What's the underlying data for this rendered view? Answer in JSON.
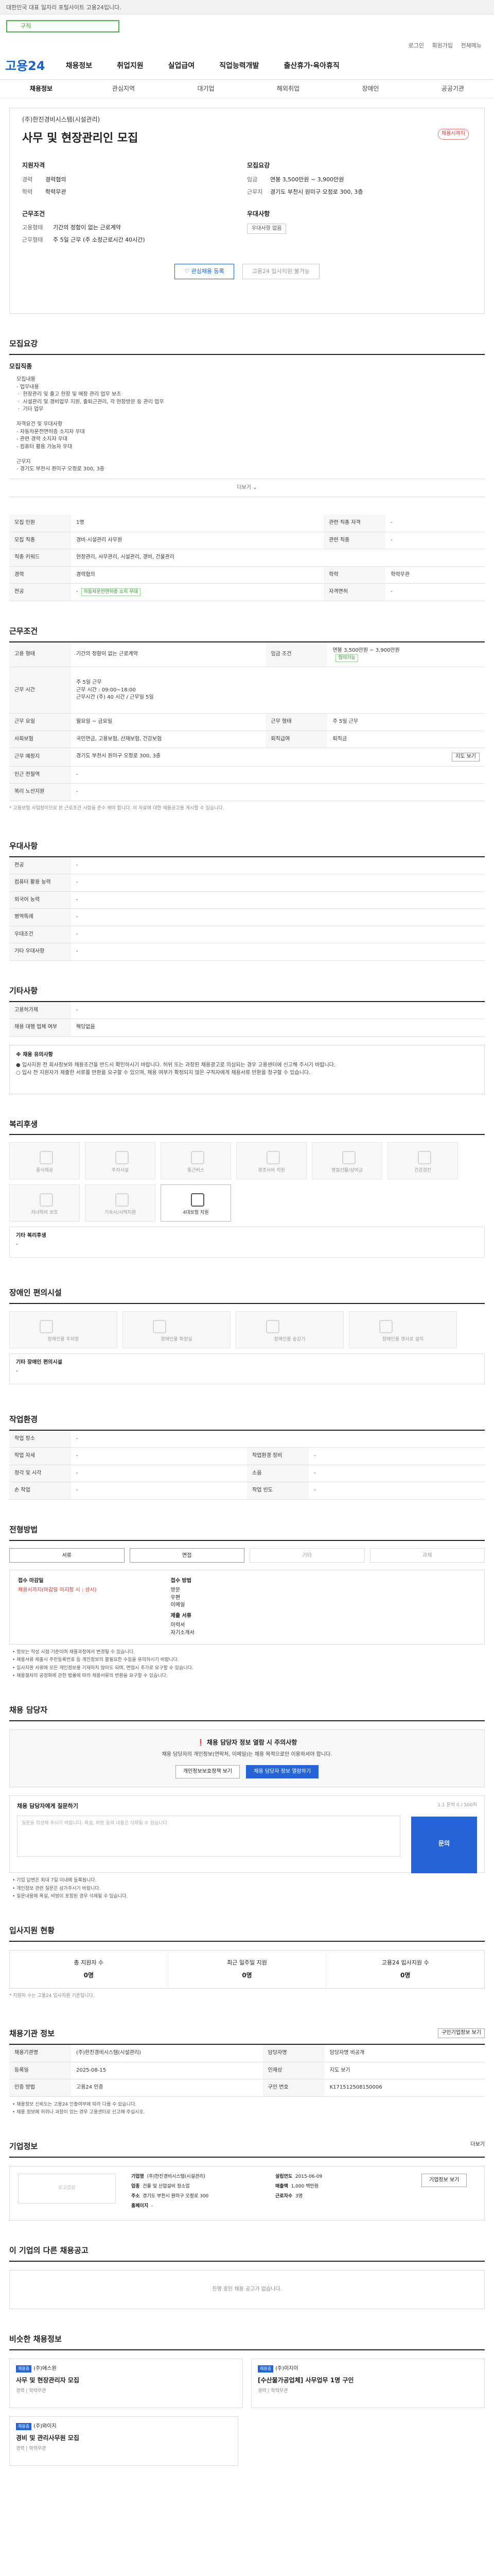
{
  "topbar": {
    "text": "대한민국 대표 일자리 포털사이트 고용24입니다."
  },
  "search": {
    "value": "구직"
  },
  "util": {
    "login": "로그인",
    "join": "회원가입",
    "sitemap": "전체메뉴"
  },
  "gnb": {
    "logo": "고용24",
    "items": [
      "채용정보",
      "취업지원",
      "실업급여",
      "직업능력개발",
      "출산휴가·육아휴직"
    ]
  },
  "subnav": [
    "채용정보",
    "관심지역",
    "대기업",
    "해외취업",
    "장애인",
    "공공기관"
  ],
  "job": {
    "company_label": "기업정보",
    "company": "(주)한진경비시스템(시설관리)",
    "title": "사무 및 현장관리인 모집",
    "close_badge": "채용시까지",
    "left_title": "지원자격",
    "left": [
      {
        "k": "경력",
        "v": "경력협의"
      },
      {
        "k": "학력",
        "v": "학력무관"
      }
    ],
    "left2_title": "근무조건",
    "left2": [
      {
        "k": "고용형태",
        "v": "기간의 정함이 없는 근로계약"
      },
      {
        "k": "근무형태",
        "v": "주 5일 근무 (주 소정근로시간 40시간)"
      }
    ],
    "right_title": "모집요강",
    "right": [
      {
        "k": "임금",
        "v": "연봉 3,500만원 ~ 3,900만원"
      },
      {
        "k": "근무지",
        "v": "경기도 부천시 원미구 오정로 300, 3층"
      }
    ],
    "right2_title": "우대사항",
    "right2_note": "우대사항 없음",
    "btn_interest": "관심채용 등록",
    "btn_apply": "고용24 입사지원 불가능"
  },
  "detail": {
    "title": "모집요강",
    "sub1": "모집직종",
    "body": "모집내용\n- 업무내용\n  ㆍ 현장관리 및 출고 현장 및 매장 관리 업무 보조\n  ㆍ 시설관리 및 경비업무 지원, 출퇴근관리, 각 현장방문 등 관리 업무\n  ㆍ 기타 업무\n\n자격요건 및 우대사항\n- 자동차운전면허증 소지자 우대\n- 관련 경력 소지자 우대\n- 컴퓨터 활용 가능자 우대\n\n근무지\n- 경기도 부천시 원미구 오정로 300, 3층",
    "more": "더보기",
    "rows": [
      {
        "k": "모집 인원",
        "v": "1명",
        "k2": "관련 직종 자격",
        "v2": "-"
      },
      {
        "k": "모집 직종",
        "v": "경비·시설관리 사무원",
        "k2": "관련 직종",
        "v2": "-"
      },
      {
        "k": "직종 키워드",
        "v": "현장관리, 사무관리, 시설관리, 경비, 건물관리",
        "k2": "",
        "v2": ""
      },
      {
        "k": "경력",
        "v": "경력협의",
        "k2": "학력",
        "v2": "학력무관"
      },
      {
        "k": "전공",
        "v": "-",
        "k2": "자격면허",
        "v2": "-"
      }
    ],
    "mid_note": "자동차운전면허증 소지 우대"
  },
  "cond": {
    "title": "근무조건",
    "rows": [
      {
        "k": "고용 형태",
        "v": "기간의 정함이 없는 근로계약",
        "k2": "임금 조건",
        "v2": "연봉 3,500만원 ~ 3,900만원",
        "tag": "협의가능"
      },
      {
        "k": "근무 시간",
        "v": "주 5일 근무",
        "k2": "",
        "v2": ""
      },
      {
        "k": "근무 요일",
        "v": "월요일 ~ 금요일",
        "k2": "근무 형태",
        "v2": "주 5일 근무"
      },
      {
        "k": "사회보험",
        "v": "국민연금, 고용보험, 산재보험, 건강보험",
        "k2": "퇴직급여",
        "v2": "퇴직금"
      },
      {
        "k": "근무 예정지",
        "v": "경기도 부천시 원미구 오정로 300, 3층",
        "k2": "",
        "v2": "",
        "btn": "지도 보기"
      },
      {
        "k": "인근 전철역",
        "v": "-",
        "k2": "",
        "v2": ""
      },
      {
        "k": "복리 노선지원",
        "v": "-",
        "k2": "",
        "v2": ""
      }
    ],
    "worktime": "근무 시간 : 09:00~18:00\n근무시간 (주) 40 시간 / 근무일 5일",
    "footnote": "* 고용보험 사업장이므로 본 근로조건 사항을 준수 해야 합니다. 이 자료에 대한 채용공고를 게시할 수 있습니다."
  },
  "pref": {
    "title": "우대사항",
    "rows": [
      {
        "k": "전공",
        "v": "-"
      },
      {
        "k": "컴퓨터 활용 능력",
        "v": "-"
      },
      {
        "k": "외국어 능력",
        "v": "-"
      },
      {
        "k": "병역특례",
        "v": "-"
      },
      {
        "k": "우대조건",
        "v": "-"
      },
      {
        "k": "기타 우대사항",
        "v": "-"
      }
    ]
  },
  "etc": {
    "title": "기타사항",
    "rows": [
      {
        "k": "고용허가제",
        "v": "-"
      },
      {
        "k": "채용 대행 업체 여부",
        "v": "해당없음"
      }
    ],
    "warn_title": "※ 채용 유의사항",
    "warn": "● 입사지원 전 회사정보와 채용조건을 반드시 확인하시기 바랍니다. 허위 또는 과장된 채용광고로 의심되는 경우 고용센터에 신고해 주시기 바랍니다.\n○ 입사 전 지원자가 제출한 서류를 반환을 요구할 수 있으며, 채용 여부가 확정되지 않은 구직자에게 채용서류 반환을 청구할 수 있습니다."
  },
  "welfare": {
    "title": "복리후생",
    "items": [
      "중식제공",
      "주차시설",
      "통근버스",
      "경조사비 지원",
      "명절선물/상여금",
      "건강검진",
      "자녀학비 보조",
      "기숙사/사택지원",
      "4대보험 지원"
    ],
    "active": "4대보험 지원",
    "other_label": "기타 복리후생",
    "other_value": "-"
  },
  "disability": {
    "title": "장애인 편의시설",
    "items": [
      "장애인용 주차장",
      "장애인용 화장실",
      "장애인용 승강기",
      "장애인용 경사로 설치"
    ],
    "other_label": "기타 장애인 편의시설",
    "other_value": "-"
  },
  "env": {
    "title": "작업환경",
    "rows": [
      {
        "k": "작업 장소",
        "v": "-",
        "k2": "",
        "v2": ""
      },
      {
        "k": "작업 자세",
        "v": "-",
        "k2": "작업환경 장비",
        "v2": "-"
      },
      {
        "k": "청각 및 시각",
        "v": "-",
        "k2": "소음",
        "v2": "-"
      },
      {
        "k": "손 작업",
        "v": "-",
        "k2": "작업 빈도",
        "v2": "-"
      }
    ]
  },
  "apply": {
    "title": "전형방법",
    "steps": [
      "서류",
      "면접",
      "기타",
      "과제"
    ],
    "active": [
      "서류",
      "면접"
    ],
    "c1_t": "접수 마감일",
    "c1_v": "채용시까지(마감일 미지정 시 : 상시)",
    "c2_t": "접수 방법",
    "c2_v": "방문\n우편\n이메일",
    "c3_t": "제출 서류",
    "c3_v": "이력서\n자기소개서",
    "notes": "• 정보는 작성 시점 기준이며 채용과정에서 변경될 수 있습니다.\n• 채용서류 제출시 주민등록번호 등 개인정보의 불필요한 수집을 유의하시기 바랍니다.\n• 입사지원 서류에 모든 개인정보를 기재하지 않아도 되며, 면접시 추가로 요구할 수 있습니다.\n• 채용절차의 공정화에 관한 법률에 따라 채용서류의 반환을 요구할 수 있습니다."
  },
  "contact": {
    "title": "채용 담당자",
    "alert": "채용 담당자 정보 열람 시 주의사항",
    "sub": "채용 담당자의 개인정보(연락처, 이메일)는 채용 목적으로만 이용하셔야 합니다.",
    "btn1": "개인정보보호정책 보기",
    "btn2": "채용 담당자 정보 열람하기",
    "inq_title": "채용 담당자에게 질문하기",
    "inq_right": "1:1 문의 0 / 500자",
    "inq_placeholder": "질문을 작성해 주시기 바랍니다. 욕설, 비방 등의 내용은 삭제될 수 있습니다.",
    "ask": "문의",
    "notes": "• 기업 답변은 최대 7일 이내에 등록됩니다.\n• 개인정보 관련 질문은 삼가주시기 바랍니다.\n• 질문내용에 욕설, 비방이 포함된 경우 삭제될 수 있습니다."
  },
  "status": {
    "title": "입사지원 현황",
    "items": [
      {
        "t": "총 지원자 수",
        "v": "0명"
      },
      {
        "t": "최근 일주일 지원",
        "v": "0명"
      },
      {
        "t": "고용24 입사지원 수",
        "v": "0명"
      }
    ],
    "note": "* 지원자 수는 고용24 입사지원 기준입니다."
  },
  "info": {
    "title": "채용기관 정보",
    "btn": "구인기업정보 보기",
    "rows": [
      {
        "k": "채용기관명",
        "v": "(주)한진경비시스템(시설관리)",
        "k2": "담당자명",
        "v2": "담당자명 비공개"
      },
      {
        "k": "등록일",
        "v": "2025-08-15",
        "k2": "인재상",
        "v2": "지도 보기"
      },
      {
        "k": "인증 방법",
        "v": "고용24 인증",
        "k2": "구인 번호",
        "v2": "K171512508150006"
      }
    ],
    "notes": "• 채용정보 신뢰도는 고용24 인증여부에 따라 다를 수 있습니다.\n• 채용 정보에 허위나 과장이 있는 경우 고용센터로 신고해 주십시오."
  },
  "corp": {
    "title": "기업정보",
    "more": "더보기",
    "logo": "로고없음",
    "rows": [
      {
        "k": "기업명",
        "v": "(주)한진경비시스템(시설관리)",
        "k2": "설립연도",
        "v2": "2015-06-09"
      },
      {
        "k": "업종",
        "v": "건물 및 산업설비 청소업",
        "k2": "매출액",
        "v2": "1,000 백만원"
      },
      {
        "k": "주소",
        "v": "경기도 부천시 원미구 오정로 300",
        "k2": "근로자수",
        "v2": "3명"
      },
      {
        "k": "홈페이지",
        "v": "-",
        "k2": "",
        "v2": ""
      }
    ],
    "btn": "기업정보 보기"
  },
  "similar": {
    "title": "이 기업의 다른 채용공고",
    "empty": "진행 중인 채용 공고가 없습니다."
  },
  "recommend": {
    "title": "비슷한 채용정보",
    "cards": [
      {
        "label": "채용중",
        "company": "(주)에스원",
        "title": "사무 및 현장관리자 모집",
        "meta": "경력 | 학력무관"
      },
      {
        "label": "채용중",
        "company": "(주)이지이",
        "title": "[수산물가공업체] 사무업무 1명 구인",
        "meta": "경력 | 학력무관"
      },
      {
        "label": "채용중",
        "company": "(주)와이지",
        "title": "경비 및 관리사무원 모집",
        "meta": "경력 | 학력무관"
      }
    ]
  }
}
